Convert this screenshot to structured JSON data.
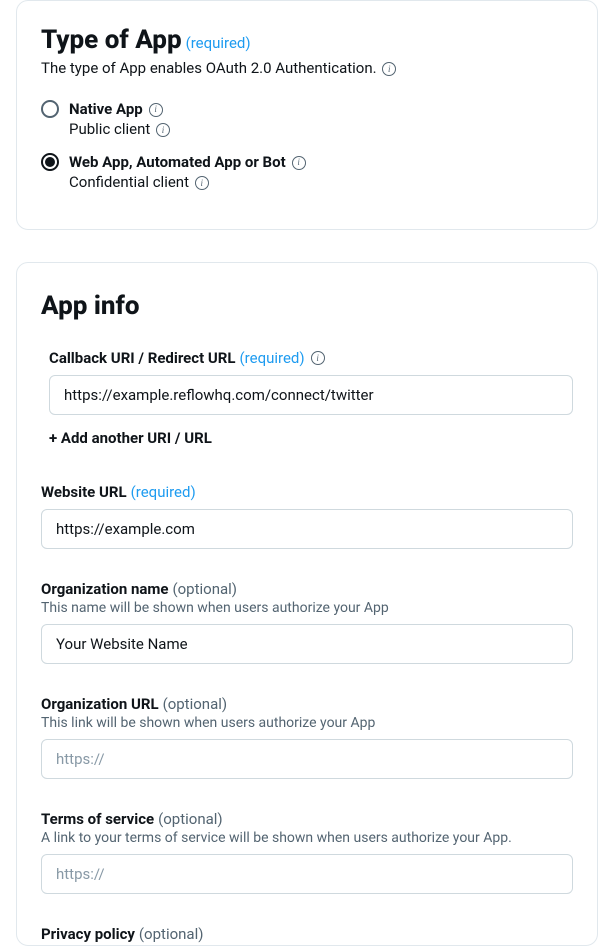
{
  "typeOfApp": {
    "title": "Type of App",
    "required": "(required)",
    "description": "The type of App enables OAuth 2.0 Authentication.",
    "options": {
      "native": {
        "label": "Native App",
        "sublabel": "Public client"
      },
      "web": {
        "label": "Web App, Automated App or Bot",
        "sublabel": "Confidential client"
      }
    }
  },
  "appInfo": {
    "title": "App info",
    "callbackUri": {
      "label": "Callback URI / Redirect URL",
      "required": "(required)",
      "value": "https://example.reflowhq.com/connect/twitter",
      "addAnother": "+ Add another URI / URL"
    },
    "websiteUrl": {
      "label": "Website URL",
      "required": "(required)",
      "value": "https://example.com"
    },
    "orgName": {
      "label": "Organization name",
      "optional": "(optional)",
      "help": "This name will be shown when users authorize your App",
      "value": "Your Website Name"
    },
    "orgUrl": {
      "label": "Organization URL",
      "optional": "(optional)",
      "help": "This link will be shown when users authorize your App",
      "placeholder": "https://"
    },
    "tos": {
      "label": "Terms of service",
      "optional": "(optional)",
      "help": "A link to your terms of service will be shown when users authorize your App.",
      "placeholder": "https://"
    },
    "privacy": {
      "label": "Privacy policy",
      "optional": "(optional)"
    }
  }
}
